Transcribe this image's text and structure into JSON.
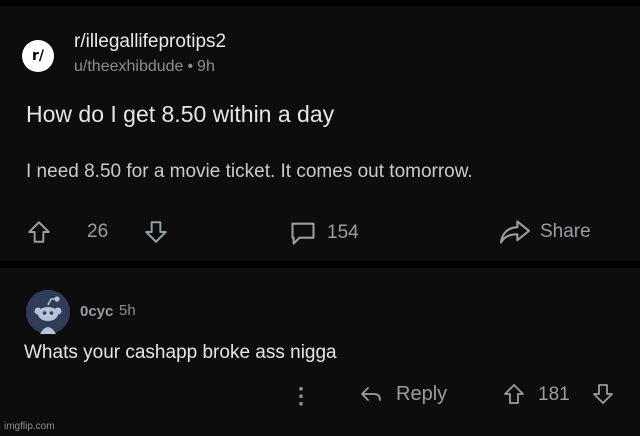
{
  "post": {
    "subreddit_icon_text": "r/",
    "subreddit": "r/illegallifeprotips2",
    "author": "u/theexhibdude",
    "separator": "•",
    "age": "9h",
    "title": "How do I get 8.50 within a day",
    "body": "I need 8.50 for a movie ticket.  It comes out tomorrow.",
    "upvotes": "26",
    "comments": "154",
    "share_label": "Share"
  },
  "comment": {
    "username": "0cyc",
    "age": "5h",
    "text": "Whats your cashapp broke ass nigga",
    "more_glyph": "⋮",
    "reply_label": "Reply",
    "votes": "181"
  },
  "watermark": "imgflip.com",
  "icons": [
    "upvote-arrow-icon",
    "downvote-arrow-icon",
    "comment-bubble-icon",
    "share-arrow-icon",
    "more-options-icon",
    "reply-arrow-icon",
    "snoo-avatar-icon"
  ]
}
